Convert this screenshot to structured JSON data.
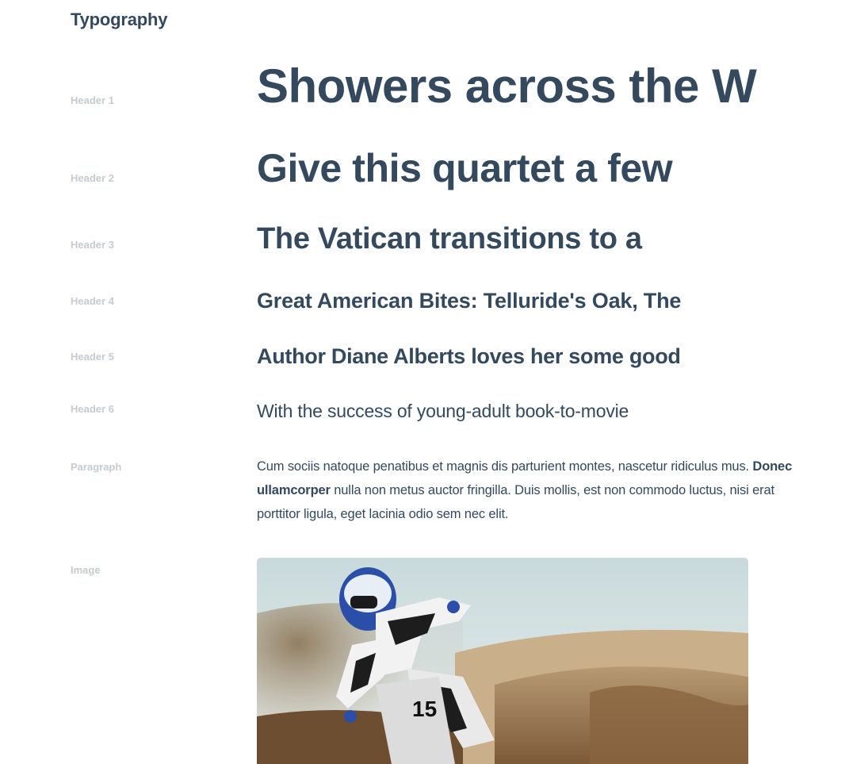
{
  "page": {
    "title": "Typography"
  },
  "rows": {
    "h1": {
      "label": "Header 1",
      "sample": "Showers across the W"
    },
    "h2": {
      "label": "Header 2",
      "sample": "Give this quartet a few"
    },
    "h3": {
      "label": "Header 3",
      "sample": "The Vatican transitions to a"
    },
    "h4": {
      "label": "Header 4",
      "sample": "Great American Bites: Telluride's Oak, The"
    },
    "h5": {
      "label": "Header 5",
      "sample": "Author Diane Alberts loves her some good"
    },
    "h6": {
      "label": "Header 6",
      "sample": "With the success of young-adult book-to-movie"
    },
    "paragraph": {
      "label": "Paragraph",
      "text_start": "Cum sociis natoque penatibus et magnis dis parturient montes, nascetur ridiculus mus.",
      "bold": "Donec ullamcorper",
      "text_end": "nulla non metus auctor fringilla. Duis mollis, est non commodo luctus, nisi erat porttitor ligula, eget lacinia odio sem nec elit."
    },
    "image": {
      "label": "Image",
      "subject": "motocross-rider-photo"
    }
  },
  "colors": {
    "heading": "#34495e",
    "label": "#c5cbd0",
    "background": "#ffffff"
  }
}
